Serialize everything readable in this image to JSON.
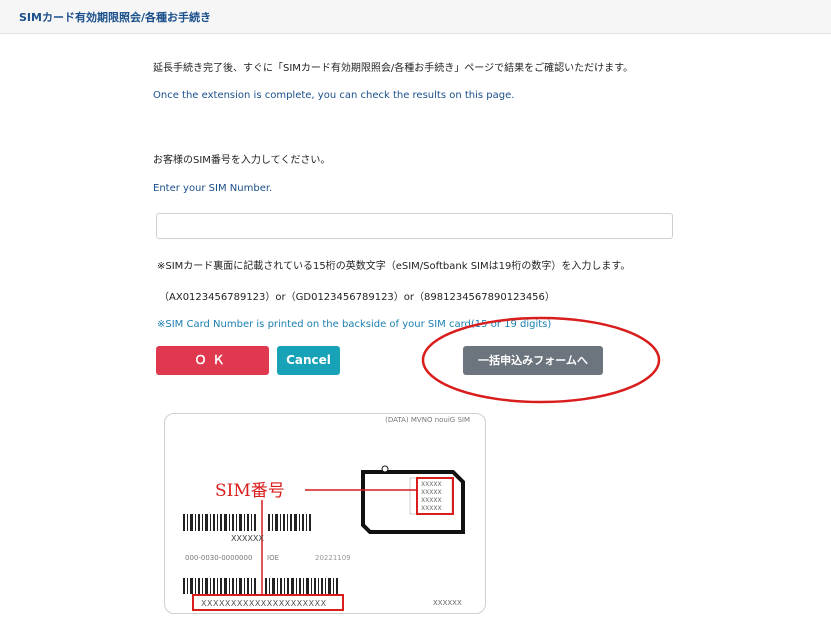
{
  "header": {
    "title": "SIMカード有効期限照会/各種お手続き"
  },
  "intro": {
    "jp": "延長手続き完了後、すぐに「SIMカード有効期限照会/各種お手続き」ページで結果をご確認いただけます。",
    "en": "Once the extension is complete, you can check the results on this page."
  },
  "prompt": {
    "jp": "お客様のSIM番号を入力してください。",
    "en": "Enter your SIM Number."
  },
  "sim_input": {
    "value": "",
    "placeholder": ""
  },
  "notes": {
    "jp": "※SIMカード裏面に記載されている15桁の英数文字（eSIM/Softbank SIMは19桁の数字）を入力します。",
    "examples": "（AX0123456789123）or（GD0123456789123）or（8981234567890123456）",
    "en": "※SIM Card Number is printed on the backside of your SIM card(15 or 19 digits)"
  },
  "buttons": {
    "ok": "ＯＫ",
    "cancel": "Cancel",
    "bulk_form": "一括申込みフォームへ"
  },
  "card_image": {
    "top_text": "(DATA) MVNO nouiG SIM",
    "label": "SIM番号",
    "chip_codes": [
      "XXXXX",
      "XXXXX",
      "XXXXX",
      "XXXXX"
    ],
    "barcode_caption": "XXXXXX",
    "serial": "000-0030-0000000",
    "ioe": "IOE",
    "date": "20221109",
    "sim_number_sample": "XXXXXXXXXXXXXXXXXXXXX",
    "corner_code": "XXXXXX"
  },
  "colors": {
    "ok": "#e0384e",
    "cancel": "#17a2b8",
    "form": "#6c757d",
    "highlight": "#d91c1c",
    "link": "#1a4f8b"
  }
}
